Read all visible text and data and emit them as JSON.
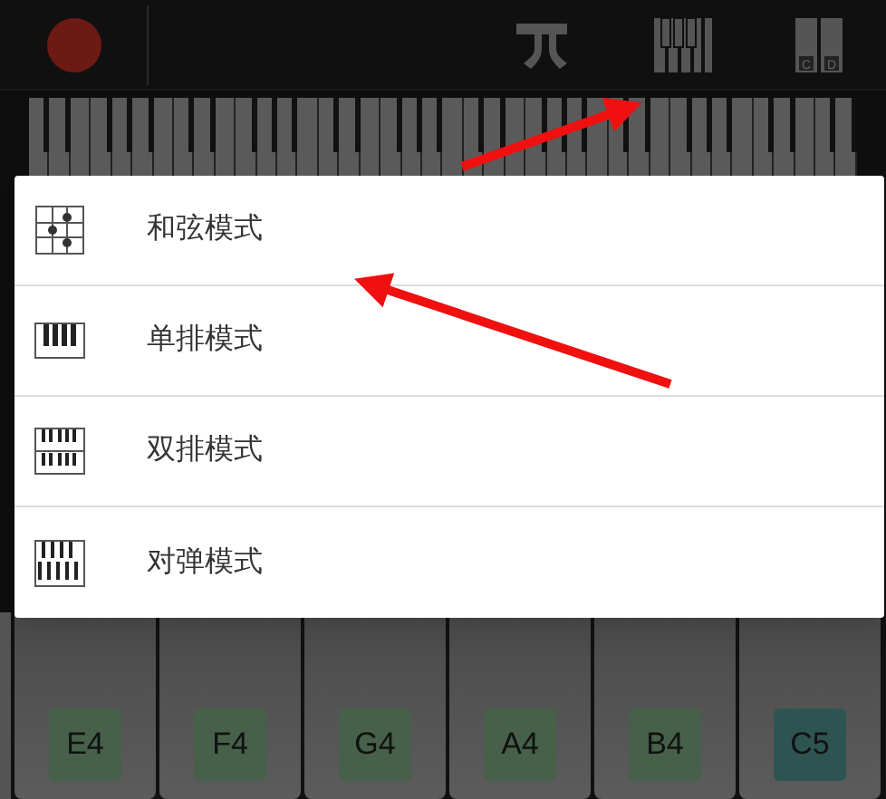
{
  "toolbar": {
    "tools": [
      {
        "kind": "pi"
      },
      {
        "kind": "single"
      },
      {
        "kind": "dual",
        "labels": [
          "C",
          "D"
        ]
      }
    ]
  },
  "menu": {
    "items": [
      {
        "kind": "chord",
        "label": "和弦模式"
      },
      {
        "kind": "single",
        "label": "单排模式"
      },
      {
        "kind": "double",
        "label": "双排模式"
      },
      {
        "kind": "duet",
        "label": "对弹模式"
      }
    ]
  },
  "keys": [
    {
      "label": "E4",
      "color": "#46604a"
    },
    {
      "label": "F4",
      "color": "#46604a"
    },
    {
      "label": "G4",
      "color": "#46604a"
    },
    {
      "label": "A4",
      "color": "#46604a"
    },
    {
      "label": "B4",
      "color": "#46604a"
    },
    {
      "label": "C5",
      "color": "#2e5452"
    }
  ]
}
